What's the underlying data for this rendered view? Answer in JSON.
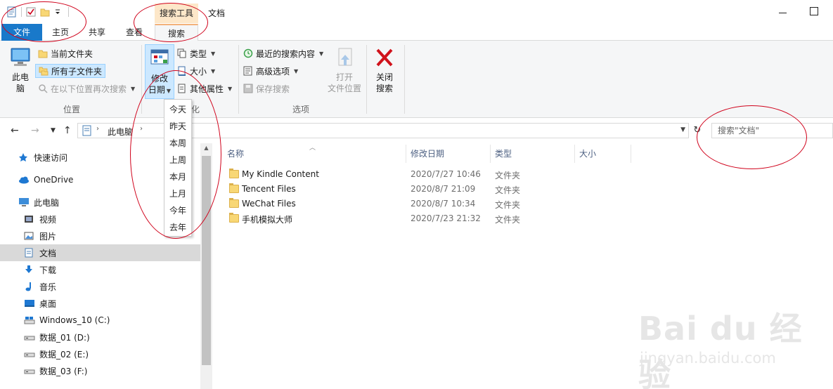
{
  "window": {
    "title": "文档",
    "context_group": "搜索工具"
  },
  "tabs": {
    "file": "文件",
    "home": "主页",
    "share": "共享",
    "view": "查看",
    "search": "搜索"
  },
  "ribbon": {
    "location": {
      "this_pc": "此电脑",
      "current_folder": "当前文件夹",
      "all_subfolders": "所有子文件夹",
      "search_again": "在以下位置再次搜索",
      "group_label": "位置"
    },
    "refine": {
      "date_modified_line1": "修改",
      "date_modified_line2": "日期",
      "kind": "类型",
      "size": "大小",
      "other_props": "其他属性",
      "group_label_visible": "化"
    },
    "options": {
      "recent_searches": "最近的搜索内容",
      "advanced_options": "高级选项",
      "save_search": "保存搜索",
      "open_location_line1": "打开",
      "open_location_line2": "文件位置",
      "group_label": "选项"
    },
    "close": {
      "line1": "关闭",
      "line2": "搜索"
    }
  },
  "date_menu": [
    "今天",
    "昨天",
    "本周",
    "上周",
    "本月",
    "上月",
    "今年",
    "去年"
  ],
  "address": {
    "crumb": "此电脑",
    "search_placeholder": "搜索\"文档\""
  },
  "nav_pane": [
    {
      "label": "快速访问",
      "icon": "star-icon"
    },
    {
      "label": "OneDrive",
      "icon": "cloud-icon"
    },
    {
      "label": "此电脑",
      "icon": "computer-icon"
    },
    {
      "label": "视频",
      "icon": "video-icon"
    },
    {
      "label": "图片",
      "icon": "pictures-icon"
    },
    {
      "label": "文档",
      "icon": "documents-icon"
    },
    {
      "label": "下载",
      "icon": "download-icon"
    },
    {
      "label": "音乐",
      "icon": "music-icon"
    },
    {
      "label": "桌面",
      "icon": "desktop-icon"
    },
    {
      "label": "Windows_10 (C:)",
      "icon": "drive-c-icon"
    },
    {
      "label": "数据_01 (D:)",
      "icon": "drive-icon"
    },
    {
      "label": "数据_02 (E:)",
      "icon": "drive-icon"
    },
    {
      "label": "数据_03 (F:)",
      "icon": "drive-icon"
    }
  ],
  "columns": {
    "name": "名称",
    "date": "修改日期",
    "type": "类型",
    "size": "大小"
  },
  "files": [
    {
      "name": "My Kindle Content",
      "date": "2020/7/27 10:46",
      "type": "文件夹"
    },
    {
      "name": "Tencent Files",
      "date": "2020/8/7 21:09",
      "type": "文件夹"
    },
    {
      "name": "WeChat Files",
      "date": "2020/8/7 10:34",
      "type": "文件夹"
    },
    {
      "name": "手机模拟大师",
      "date": "2020/7/23 21:32",
      "type": "文件夹"
    }
  ],
  "watermark": {
    "brand": "Bai du 经验",
    "url": "jingyan.baidu.com"
  },
  "colors": {
    "accent": "#1979ca",
    "context_tab": "#fde7c9",
    "selection": "#cce8ff",
    "annotation": "#d0021b"
  }
}
